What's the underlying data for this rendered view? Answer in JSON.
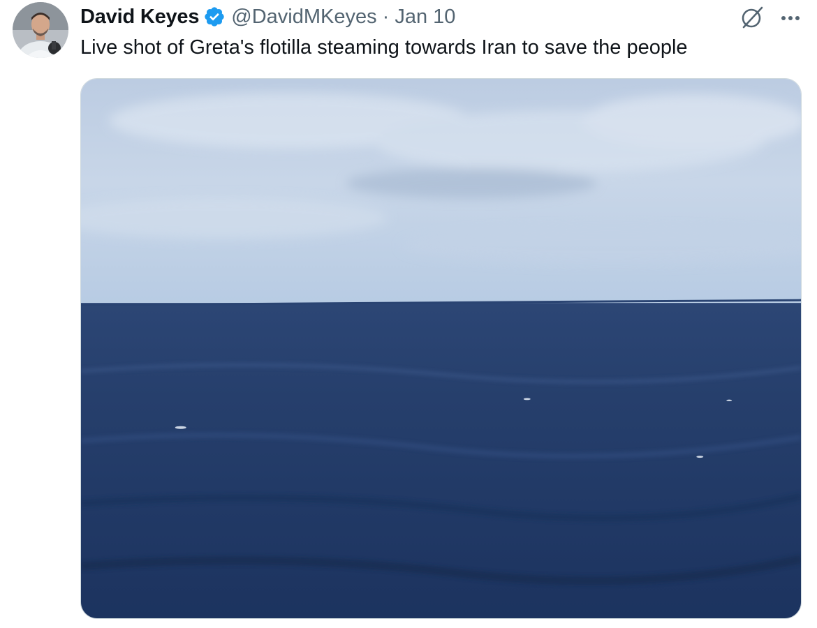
{
  "tweet": {
    "author_name": "David Keyes",
    "handle": "@DavidMKeyes",
    "separator": "·",
    "date": "Jan 10",
    "text": "Live shot of Greta's flotilla steaming towards Iran to save the people",
    "verified": true,
    "icons": {
      "verified": "verified-badge-icon",
      "grok": "grok-icon",
      "more": "more-options-icon"
    },
    "colors": {
      "verified_blue": "#1d9bf0",
      "secondary_text": "#536471",
      "primary_text": "#0f1419"
    },
    "media": {
      "description_kind": "photo",
      "sky_color": "#c9d6e6",
      "sea_color": "#1f3a6b"
    }
  }
}
